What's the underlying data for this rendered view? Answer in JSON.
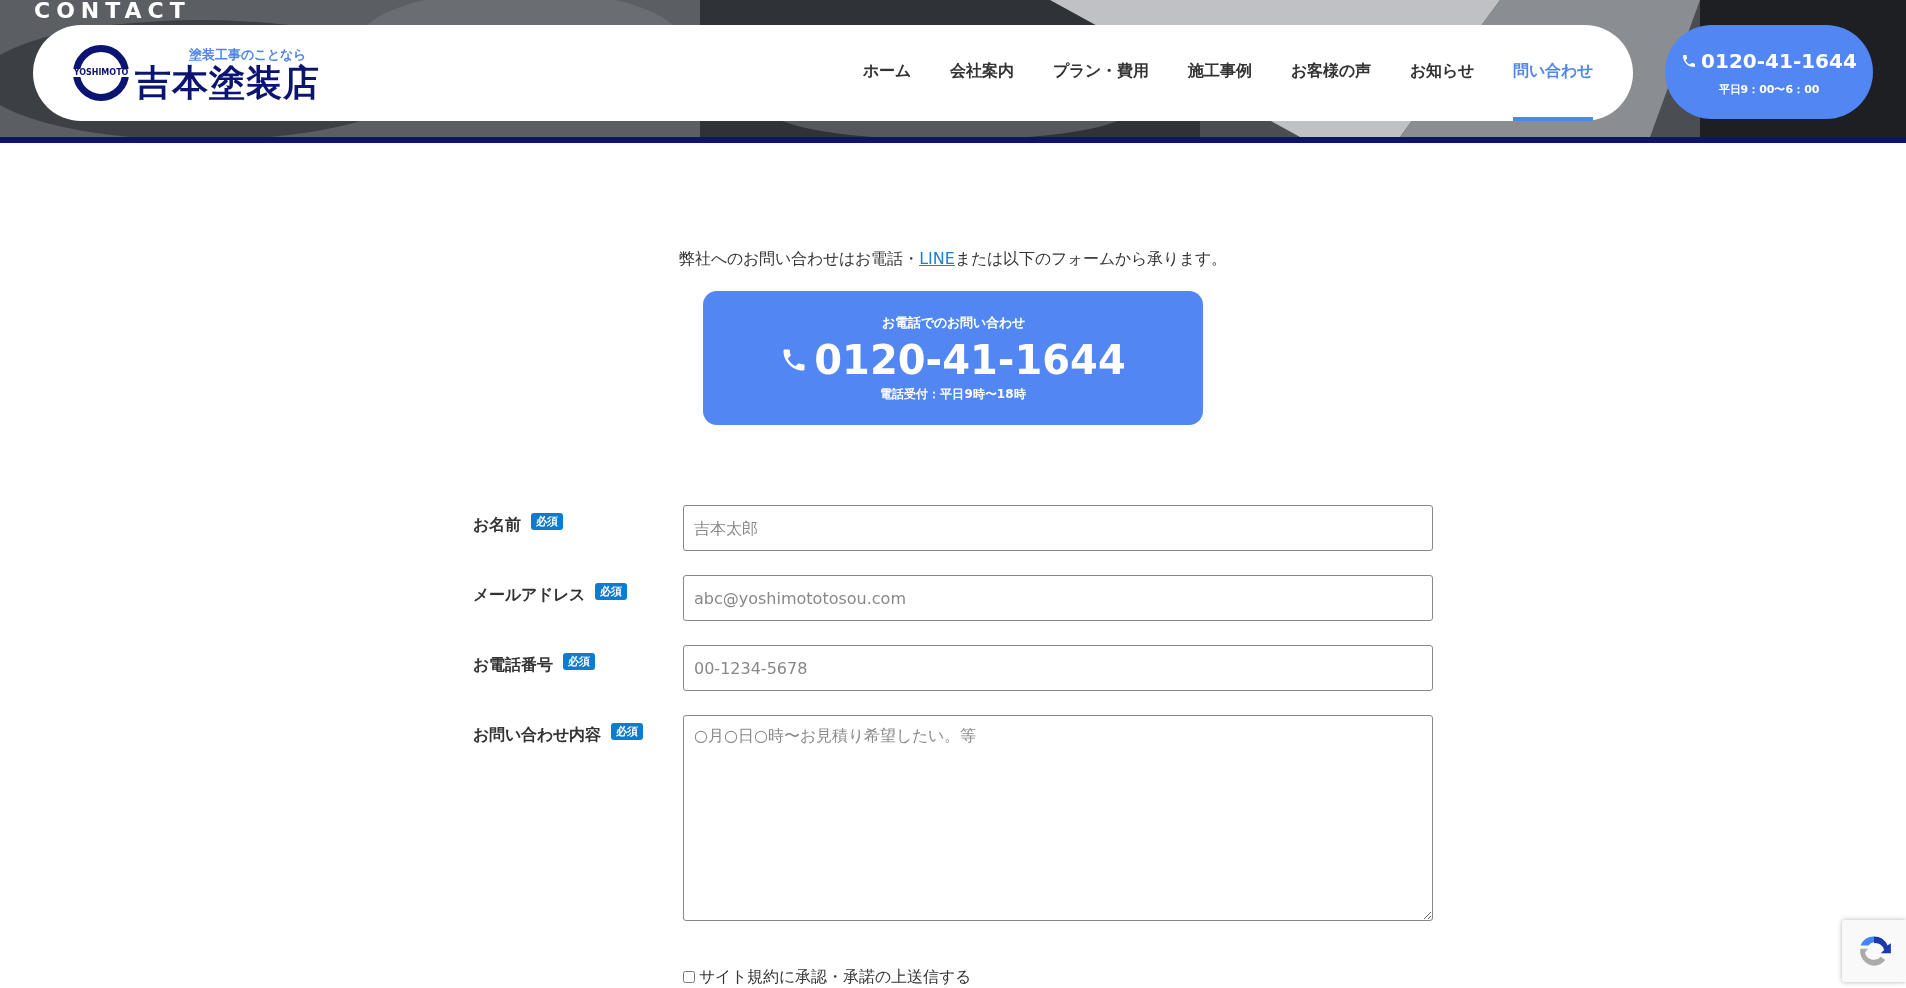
{
  "hero": {
    "title": "CONTACT",
    "kind": "picture"
  },
  "logo": {
    "tagline": "塗装工事のことなら",
    "mark_text": "YOSHIMOTO",
    "name": "吉本塗装店"
  },
  "nav": [
    {
      "label": "ホーム",
      "selected": false
    },
    {
      "label": "会社案内",
      "selected": false
    },
    {
      "label": "プラン・費用",
      "selected": false
    },
    {
      "label": "施工事例",
      "selected": false
    },
    {
      "label": "お客様の声",
      "selected": false
    },
    {
      "label": "お知らせ",
      "selected": false
    },
    {
      "label": "問い合わせ",
      "selected": true
    }
  ],
  "header_phone": {
    "number": "0120-41-1644",
    "hours": "平日9：00〜6：00"
  },
  "intro": {
    "before": "弊社へのお問い合わせはお電話・",
    "link": "LINE",
    "after": "または以下のフォームから承ります。"
  },
  "phone_card": {
    "caption": "お電話でのお問い合わせ",
    "number": "0120-41-1644",
    "hours": "電話受付：平日9時〜18時"
  },
  "form": [
    {
      "label": "お名前",
      "badge": "必須",
      "kind": "input",
      "placeholder": "吉本太郎"
    },
    {
      "label": "メールアドレス",
      "badge": "必須",
      "kind": "input",
      "placeholder": "abc@yoshimototosou.com"
    },
    {
      "label": "お電話番号",
      "badge": "必須",
      "kind": "input",
      "placeholder": "00-1234-5678"
    },
    {
      "label": "お問い合わせ内容",
      "badge": "必須",
      "kind": "textarea",
      "placeholder": "○月○日○時〜お見積り希望したい。等"
    }
  ],
  "consent": {
    "label": "サイト規約に承認・承諾の上送信する",
    "checked": false
  }
}
